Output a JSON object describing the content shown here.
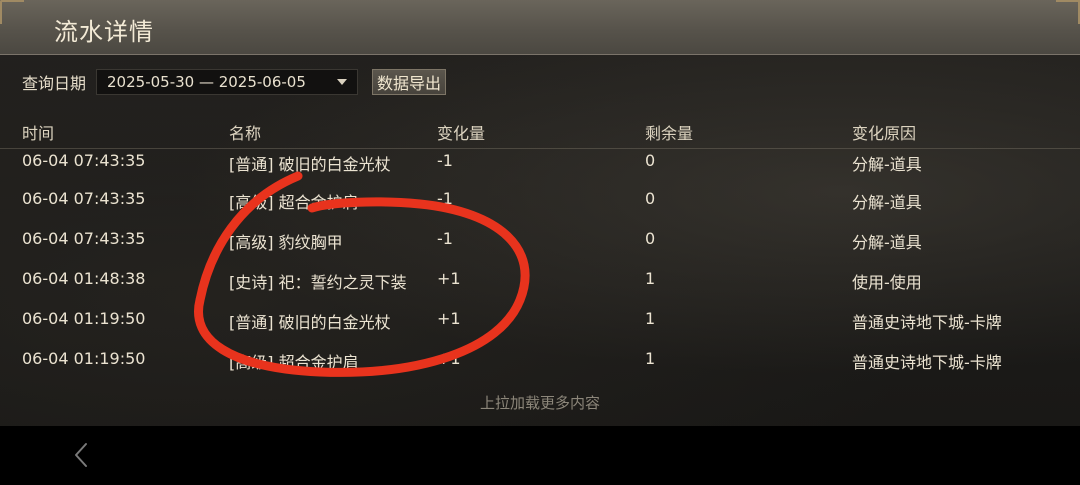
{
  "header": {
    "title": "流水详情"
  },
  "filter": {
    "label": "查询日期",
    "date_range": "2025-05-30 — 2025-06-05",
    "export_label": "数据导出"
  },
  "table": {
    "columns": [
      "时间",
      "名称",
      "变化量",
      "剩余量",
      "变化原因"
    ],
    "rows": [
      {
        "time": "06-04 07:43:35",
        "name": "[普通] 破旧的白金光杖",
        "change": "-1",
        "remain": "0",
        "reason": "分解-道具"
      },
      {
        "time": "06-04 07:43:35",
        "name": "[高级] 超合金护肩",
        "change": "-1",
        "remain": "0",
        "reason": "分解-道具"
      },
      {
        "time": "06-04 07:43:35",
        "name": "[高级] 豹纹胸甲",
        "change": "-1",
        "remain": "0",
        "reason": "分解-道具"
      },
      {
        "time": "06-04 01:48:38",
        "name": "[史诗] 祀：誓约之灵下装",
        "change": "+1",
        "remain": "1",
        "reason": "使用-使用"
      },
      {
        "time": "06-04 01:19:50",
        "name": "[普通] 破旧的白金光杖",
        "change": "+1",
        "remain": "1",
        "reason": "普通史诗地下城-卡牌"
      },
      {
        "time": "06-04 01:19:50",
        "name": "[高级] 超合金护肩",
        "change": "+1",
        "remain": "1",
        "reason": "普通史诗地下城-卡牌"
      }
    ]
  },
  "footer": {
    "load_more": "上拉加载更多内容"
  },
  "colors": {
    "annotation": "#e8331d",
    "accent_gold": "#a08a63"
  },
  "icons": {
    "back": "chevron-left-icon",
    "dropdown": "caret-down-icon"
  }
}
